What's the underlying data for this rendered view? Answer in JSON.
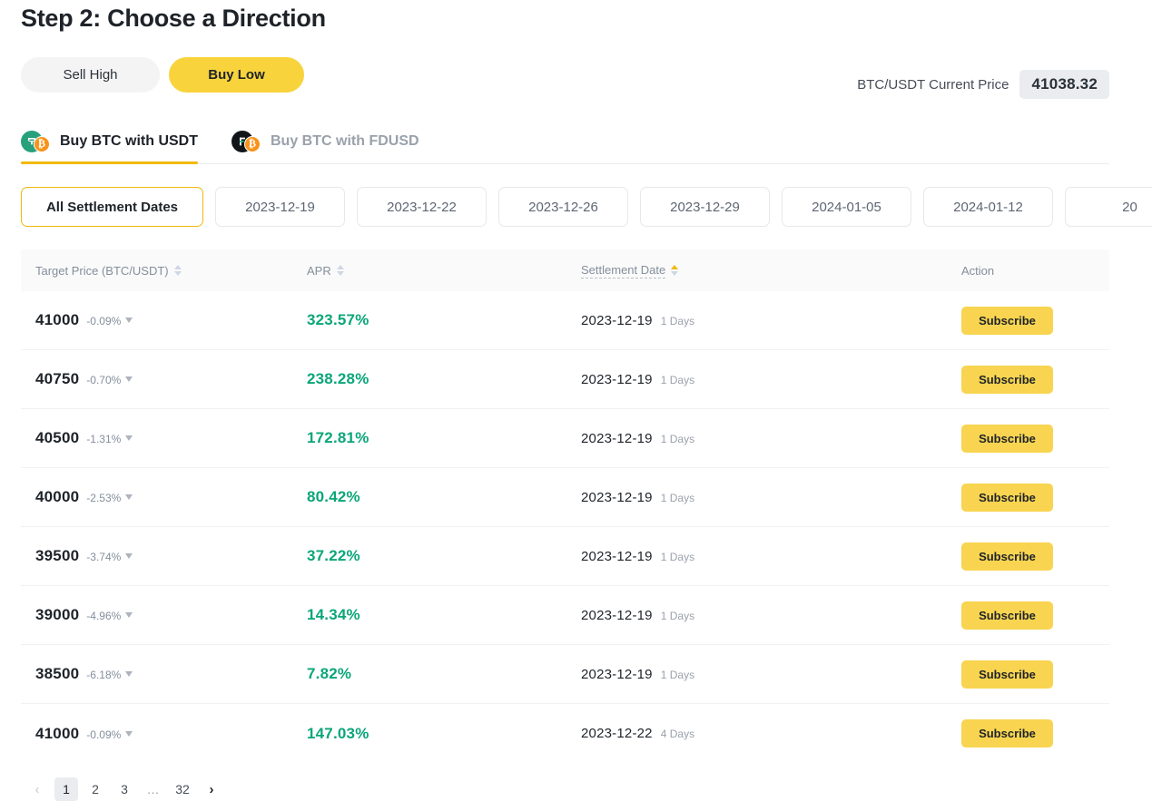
{
  "page_title": "Step 2: Choose a Direction",
  "direction_toggle": {
    "sell_high_label": "Sell High",
    "buy_low_label": "Buy Low",
    "active": "Buy Low"
  },
  "current_price": {
    "label": "BTC/USDT Current Price",
    "value": "41038.32"
  },
  "pair_tabs": [
    {
      "label": "Buy BTC with USDT",
      "icon": "usdt-btc-pair-icon",
      "base_symbol": "₮",
      "overlay_symbol": "₿",
      "active": true
    },
    {
      "label": "Buy BTC with FDUSD",
      "icon": "fdusd-btc-pair-icon",
      "base_symbol": "F",
      "overlay_symbol": "₿",
      "active": false
    }
  ],
  "date_filters": [
    {
      "label": "All Settlement Dates",
      "active": true
    },
    {
      "label": "2023-12-19",
      "active": false
    },
    {
      "label": "2023-12-22",
      "active": false
    },
    {
      "label": "2023-12-26",
      "active": false
    },
    {
      "label": "2023-12-29",
      "active": false
    },
    {
      "label": "2024-01-05",
      "active": false
    },
    {
      "label": "2024-01-12",
      "active": false
    },
    {
      "label": "20",
      "active": false
    }
  ],
  "table": {
    "columns": [
      {
        "label": "Target Price (BTC/USDT)",
        "sortable": true,
        "sort": "none",
        "dotted": false
      },
      {
        "label": "APR",
        "sortable": true,
        "sort": "none",
        "dotted": false
      },
      {
        "label": "Settlement Date",
        "sortable": true,
        "sort": "asc",
        "dotted": true
      },
      {
        "label": "Action",
        "sortable": false,
        "sort": "none",
        "dotted": false
      }
    ],
    "rows": [
      {
        "target_price": "41000",
        "delta": "-0.09%",
        "apr": "323.57%",
        "settlement_date": "2023-12-19",
        "days": "1 Days",
        "action_label": "Subscribe"
      },
      {
        "target_price": "40750",
        "delta": "-0.70%",
        "apr": "238.28%",
        "settlement_date": "2023-12-19",
        "days": "1 Days",
        "action_label": "Subscribe"
      },
      {
        "target_price": "40500",
        "delta": "-1.31%",
        "apr": "172.81%",
        "settlement_date": "2023-12-19",
        "days": "1 Days",
        "action_label": "Subscribe"
      },
      {
        "target_price": "40000",
        "delta": "-2.53%",
        "apr": "80.42%",
        "settlement_date": "2023-12-19",
        "days": "1 Days",
        "action_label": "Subscribe"
      },
      {
        "target_price": "39500",
        "delta": "-3.74%",
        "apr": "37.22%",
        "settlement_date": "2023-12-19",
        "days": "1 Days",
        "action_label": "Subscribe"
      },
      {
        "target_price": "39000",
        "delta": "-4.96%",
        "apr": "14.34%",
        "settlement_date": "2023-12-19",
        "days": "1 Days",
        "action_label": "Subscribe"
      },
      {
        "target_price": "38500",
        "delta": "-6.18%",
        "apr": "7.82%",
        "settlement_date": "2023-12-19",
        "days": "1 Days",
        "action_label": "Subscribe"
      },
      {
        "target_price": "41000",
        "delta": "-0.09%",
        "apr": "147.03%",
        "settlement_date": "2023-12-22",
        "days": "4 Days",
        "action_label": "Subscribe"
      }
    ]
  },
  "pagination": {
    "prev_icon": "‹",
    "next_icon": "›",
    "items": [
      "1",
      "2",
      "3",
      "…",
      "32"
    ],
    "current": "1",
    "prev_enabled": false,
    "next_enabled": true
  },
  "colors": {
    "accent_yellow": "#f0b90b",
    "button_yellow": "#f8d450",
    "apr_green": "#0ba678",
    "text_primary": "#1e2329",
    "text_muted": "#848e9c",
    "header_bg": "#fafafa",
    "chip_bg": "#eaecef"
  }
}
